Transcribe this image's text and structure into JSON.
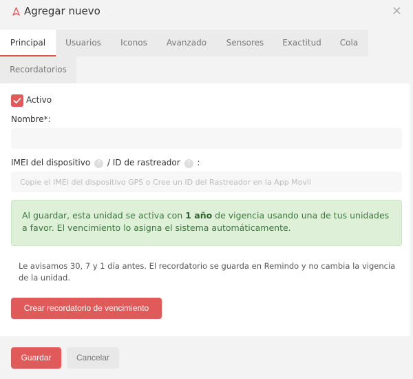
{
  "dialog": {
    "title": "Agregar nuevo",
    "close_glyph": "×"
  },
  "tabs": [
    {
      "label": "Principal"
    },
    {
      "label": "Usuarios"
    },
    {
      "label": "Iconos"
    },
    {
      "label": "Avanzado"
    },
    {
      "label": "Sensores"
    },
    {
      "label": "Exactitud"
    },
    {
      "label": "Cola"
    },
    {
      "label": "Recordatorios"
    }
  ],
  "form": {
    "active_label": "Activo",
    "active_checked": true,
    "name_label": "Nombre*:",
    "name_value": "",
    "imei_label_part1": "IMEI del dispositivo",
    "imei_label_part2": " / ID de rastreador",
    "imei_label_part3": " :",
    "help_glyph": "?",
    "imei_placeholder": "Copie el IMEI del dispositivo GPS o Cree un ID del Rastreador en la App Movil",
    "imei_value": ""
  },
  "alert": {
    "text_before": "Al guardar, esta unidad se activa con ",
    "text_bold": "1 año",
    "text_after": " de vigencia usando una de tus unidades a favor. El vencimiento lo asigna el sistema automáticamente."
  },
  "notice": {
    "text": "Le avisamos 30, 7 y 1 día antes. El recordatorio se guarda en Remindo y no cambia la vigencia de la unidad."
  },
  "buttons": {
    "create_reminder": "Crear recordatorio de vencimiento",
    "save": "Guardar",
    "cancel": "Cancelar"
  },
  "colors": {
    "accent": "#e05a5a",
    "alert_bg": "#dff0d8",
    "alert_text": "#3c763d"
  }
}
